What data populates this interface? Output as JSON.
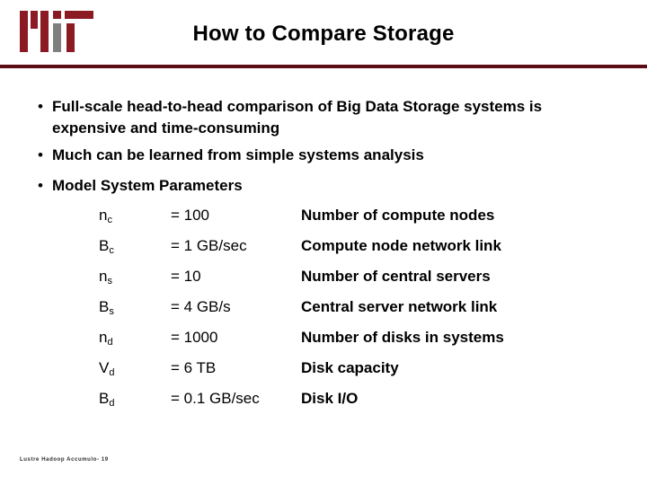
{
  "header": {
    "title": "How to Compare Storage",
    "logo_name": "mit-logo",
    "rule_color": "#5c0d14",
    "logo_color": "#8b1a23",
    "logo_accent_color": "#7f7f7f"
  },
  "bullets": [
    {
      "mark": "•",
      "text": "Full-scale head-to-head comparison of Big Data Storage systems is expensive and time-consuming"
    },
    {
      "mark": "•",
      "text": "Much can be learned from simple systems analysis"
    },
    {
      "mark": "•",
      "text": "Model System Parameters"
    }
  ],
  "param_table": {
    "rows": [
      {
        "symbol_base": "n",
        "symbol_sub": "c",
        "value": "= 100",
        "desc": "Number of compute nodes"
      },
      {
        "symbol_base": "B",
        "symbol_sub": "c",
        "value": "= 1 GB/sec",
        "desc": "Compute node network link"
      },
      {
        "symbol_base": "n",
        "symbol_sub": "s",
        "value": "= 10",
        "desc": "Number of central servers"
      },
      {
        "symbol_base": "B",
        "symbol_sub": "s",
        "value": "= 4 GB/s",
        "desc": "Central server network link"
      },
      {
        "symbol_base": "n",
        "symbol_sub": "d",
        "value": "= 1000",
        "desc": "Number of disks in systems"
      },
      {
        "symbol_base": "V",
        "symbol_sub": "d",
        "value": "= 6 TB",
        "desc": "Disk capacity"
      },
      {
        "symbol_base": "B",
        "symbol_sub": "d",
        "value": "= 0.1 GB/sec",
        "desc": "Disk I/O"
      }
    ]
  },
  "footer": {
    "text": "Lustre Hadoop Accumulo- 19"
  }
}
